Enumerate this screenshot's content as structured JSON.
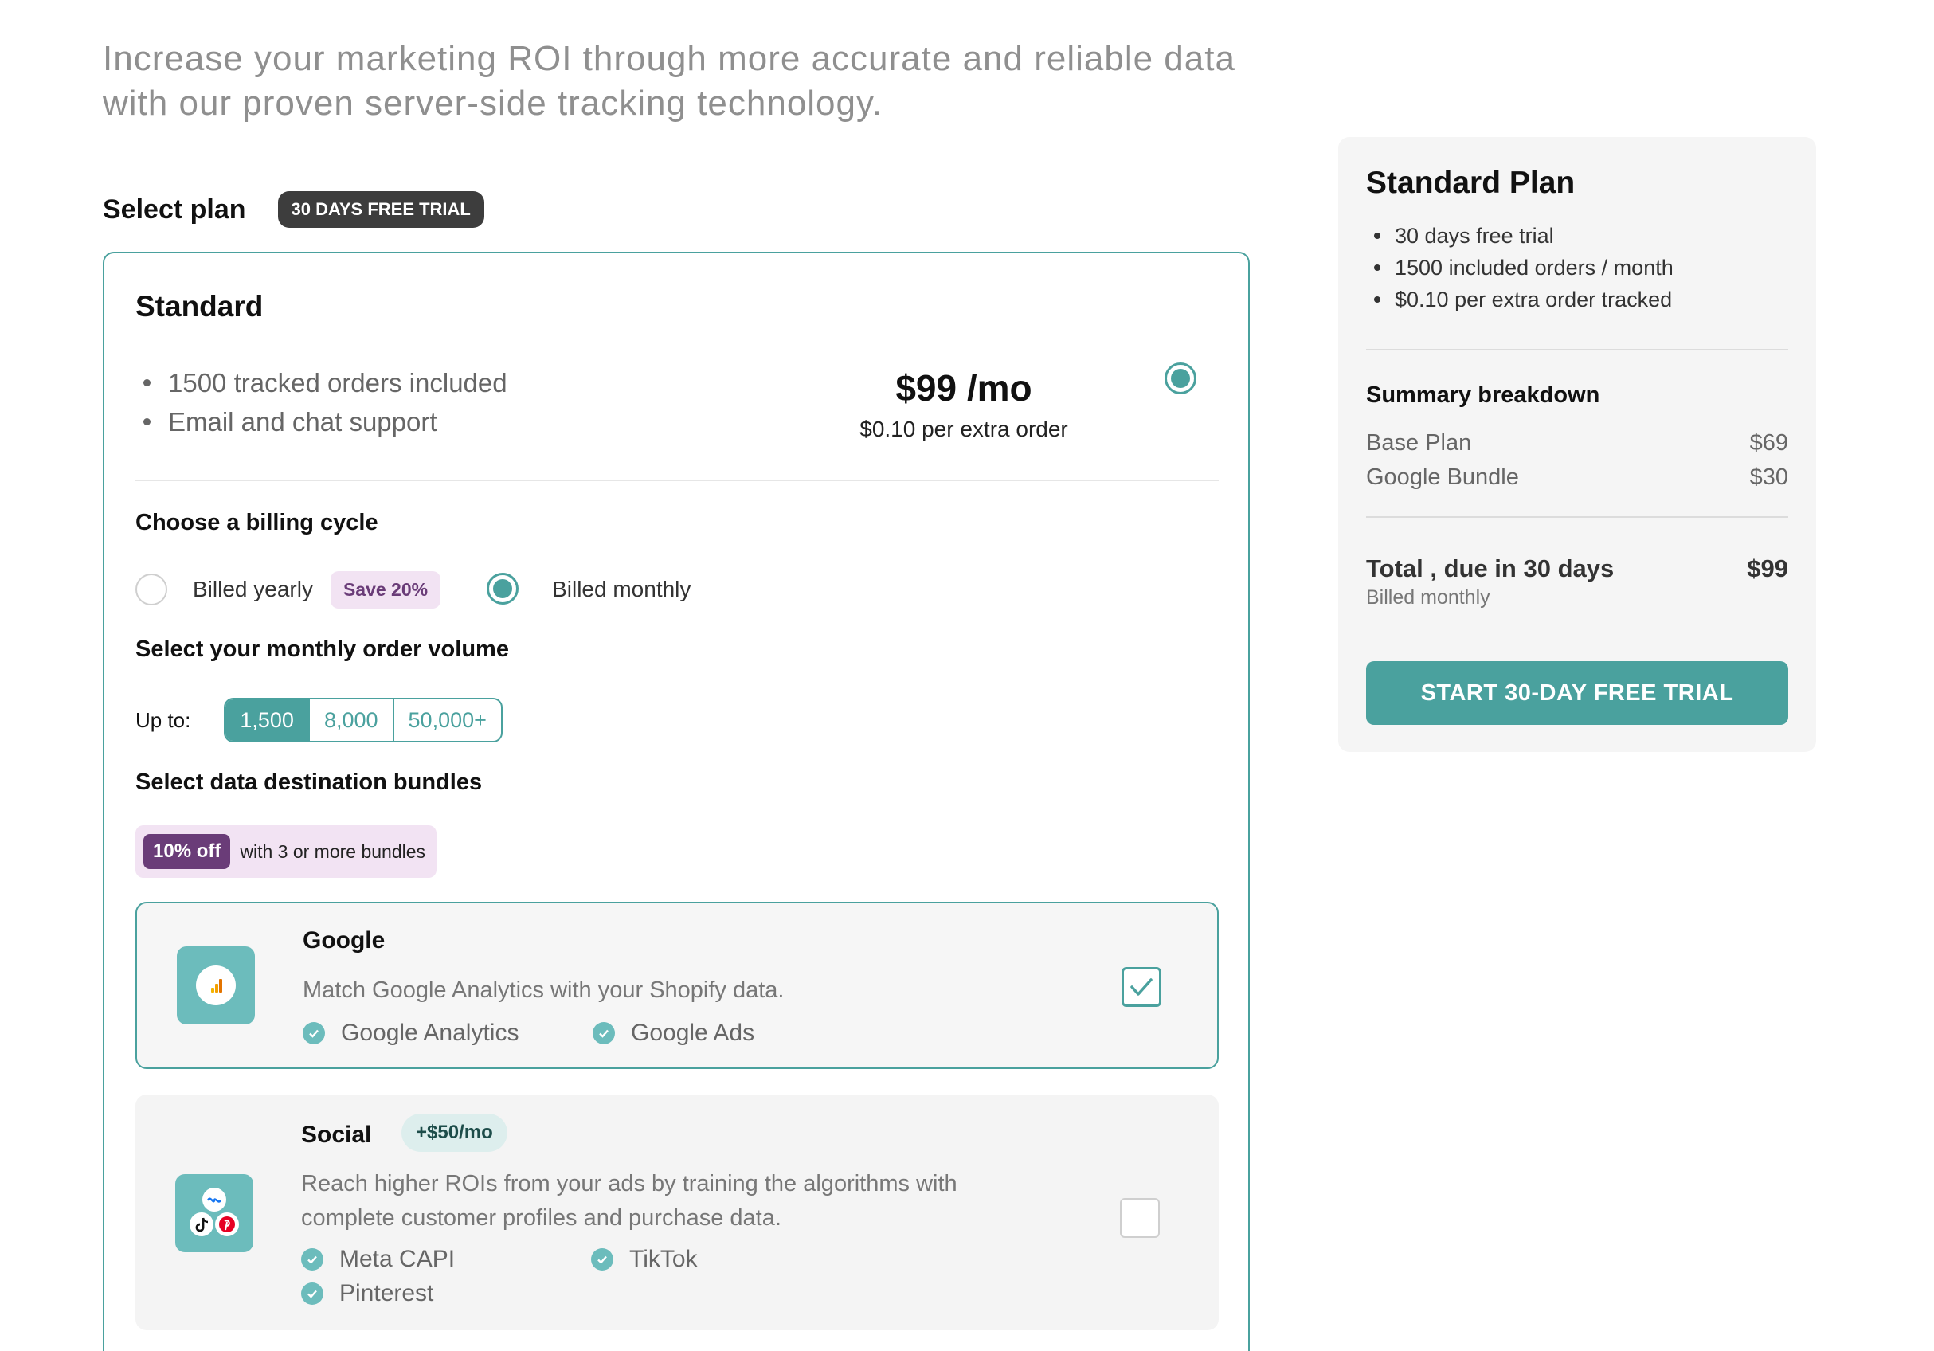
{
  "intro": {
    "line1": "Increase your marketing ROI through more accurate and reliable data",
    "line2": "with our proven server-side tracking technology."
  },
  "plan_select": {
    "title": "Select plan",
    "badge": "30 DAYS FREE TRIAL"
  },
  "plan": {
    "name": "Standard",
    "features": [
      "1500 tracked orders included",
      "Email and chat support"
    ],
    "price": "$99 /mo",
    "extra": "$0.10 per extra order",
    "selected": true
  },
  "billing": {
    "label": "Choose a billing cycle",
    "yearly": "Billed yearly",
    "save": "Save 20%",
    "monthly": "Billed monthly",
    "selected": "monthly"
  },
  "volume": {
    "label": "Select your monthly order volume",
    "upto": "Up to:",
    "options": [
      "1,500",
      "8,000",
      "50,000+"
    ],
    "selected": "1,500"
  },
  "bundles": {
    "label": "Select data destination bundles",
    "discount_pill": "10% off",
    "discount_text": "with 3 or more bundles",
    "google": {
      "name": "Google",
      "desc": "Match Google Analytics with your Shopify data.",
      "items": [
        "Google Analytics",
        "Google Ads"
      ],
      "checked": true
    },
    "social": {
      "name": "Social",
      "price": "+$50/mo",
      "desc_line1": "Reach higher ROIs from your ads by training the algorithms with",
      "desc_line2": "complete customer profiles and purchase data.",
      "items": [
        "Meta CAPI",
        "TikTok",
        "Pinterest"
      ],
      "checked": false
    }
  },
  "summary": {
    "title": "Standard Plan",
    "items": [
      "30 days free trial",
      "1500 included orders / month",
      "$0.10 per extra order tracked"
    ],
    "breakdown_label": "Summary breakdown",
    "rows": [
      {
        "label": "Base Plan",
        "value": "$69"
      },
      {
        "label": "Google Bundle",
        "value": "$30"
      }
    ],
    "total_label": "Total , due in 30 days",
    "total_value": "$99",
    "billed": "Billed monthly",
    "cta": "START 30-DAY FREE TRIAL"
  },
  "colors": {
    "accent": "#4aa19e",
    "purple": "#6a3c78",
    "purple_bg": "#f2e3f3"
  }
}
